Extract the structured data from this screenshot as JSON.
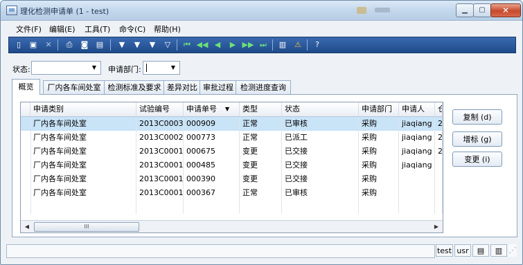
{
  "window": {
    "title": "理化检测申请单 (1 - test)"
  },
  "menu": [
    "文件(F)",
    "编辑(E)",
    "工具(T)",
    "命令(C)",
    "帮助(H)"
  ],
  "filter": {
    "status_label": "状态:",
    "status_value": "",
    "dept_label": "申请部门:",
    "dept_value": ""
  },
  "tabs": [
    "概览",
    "厂内各车间处室",
    "检测标准及要求",
    "差异对比",
    "审批过程",
    "检测进度查询"
  ],
  "grid": {
    "columns": [
      "申请类别",
      "试验编号",
      "申请单号",
      "类型",
      "状态",
      "申请部门",
      "申请人",
      "仓"
    ],
    "rows": [
      [
        "厂内各车间处室",
        "2013C0003",
        "000909",
        "正常",
        "已审核",
        "采购",
        "jiaqiang",
        "2("
      ],
      [
        "厂内各车间处室",
        "2013C0002",
        "000773",
        "正常",
        "已派工",
        "采购",
        "jiaqiang",
        "2("
      ],
      [
        "厂内各车间处室",
        "2013C0001",
        "000675",
        "变更",
        "已交接",
        "采购",
        "jiaqiang",
        "2("
      ],
      [
        "厂内各车间处室",
        "2013C0001",
        "000485",
        "变更",
        "已交接",
        "采购",
        "jiaqiang",
        ""
      ],
      [
        "厂内各车间处室",
        "2013C0001",
        "000390",
        "变更",
        "已交接",
        "采购",
        "",
        ""
      ],
      [
        "厂内各车间处室",
        "2013C0001",
        "000367",
        "正常",
        "已审核",
        "采购",
        "",
        ""
      ]
    ],
    "scroll_thumb": "III"
  },
  "actions": {
    "copy": "复制 (d)",
    "add": "增标 (g)",
    "change": "变更 (i)"
  },
  "status": {
    "company": "test",
    "user": "usr"
  },
  "icons": [
    "new-icon",
    "save-icon",
    "delete-icon",
    "print-icon",
    "preview-icon",
    "export-icon",
    "filter-icon",
    "filter-by-selection-icon",
    "advanced-filter-icon",
    "remove-filter-icon",
    "first-record-icon",
    "previous-page-icon",
    "previous-record-icon",
    "next-record-icon",
    "next-page-icon",
    "last-record-icon",
    "attachment-icon",
    "alert-icon",
    "help-icon"
  ]
}
